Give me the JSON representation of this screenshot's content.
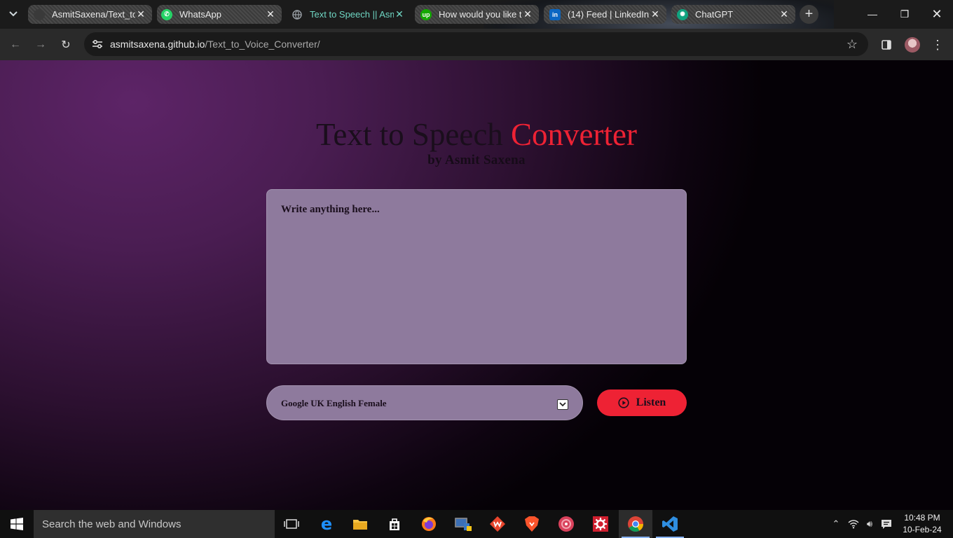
{
  "browser": {
    "tabs": [
      {
        "title": "AsmitSaxena/Text_to",
        "state": "inactive",
        "icon": "github-icon"
      },
      {
        "title": "WhatsApp",
        "state": "inactive",
        "icon": "whatsapp-icon"
      },
      {
        "title": "Text to Speech || Asm",
        "state": "active",
        "icon": "globe-icon"
      },
      {
        "title": "How would you like t",
        "state": "inactive",
        "icon": "upwork-icon"
      },
      {
        "title": "(14) Feed | LinkedIn",
        "state": "inactive",
        "icon": "linkedin-icon"
      },
      {
        "title": "ChatGPT",
        "state": "inactive",
        "icon": "chatgpt-icon"
      }
    ],
    "url_host": "asmitsaxena.github.io",
    "url_path": "/Text_to_Voice_Converter/"
  },
  "page": {
    "title_main": "Text to Speech ",
    "title_accent": "Converter",
    "byline": "by Asmit Saxena",
    "textarea_placeholder": "Write anything here...",
    "voice_selected": "Google UK English Female",
    "listen_label": "Listen"
  },
  "colors": {
    "accent": "#ee2234",
    "panel": "#8e7a9d",
    "bg_purple": "#5d2467"
  },
  "taskbar": {
    "search_placeholder": "Search the web and Windows",
    "time": "10:48 PM",
    "date": "10-Feb-24",
    "apps": [
      "task-view-icon",
      "edge-icon",
      "file-explorer-icon",
      "store-icon",
      "firefox-icon",
      "python-icon",
      "wps-icon",
      "brave-icon",
      "music-icon",
      "settings-app-icon",
      "chrome-icon",
      "vscode-icon"
    ]
  }
}
